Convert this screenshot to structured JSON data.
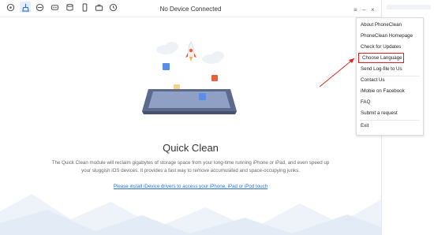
{
  "window": {
    "title": "No Device Connected"
  },
  "toolbar": {
    "icons": [
      "device-icon",
      "clean-icon",
      "sync-icon",
      "mask-icon",
      "database-icon",
      "phone-icon",
      "toolbox-icon",
      "history-icon"
    ],
    "menu_glyph": "≡",
    "minimize_glyph": "–",
    "close_glyph": "×"
  },
  "main": {
    "heading": "Quick Clean",
    "description": "The Quick Clean module will reclaim gigabytes of storage space from your long-time running iPhone or iPad, and even speed up your sluggish iOS devices. It provides a fast way to remove accumulated and space-occupying junks.",
    "link_text": "Please install iDevice drivers to access your iPhone, iPad or iPod touch"
  },
  "menu": {
    "items": [
      "About PhoneClean",
      "PhoneClean Homepage",
      "Check for Updates",
      "Choose Language",
      "Send Log-file to Us",
      "Contact Us",
      "iMobie on Facebook",
      "FAQ",
      "Submit a request",
      "Exit"
    ],
    "highlighted_index": 3
  },
  "colors": {
    "accent": "#2b6fd6",
    "highlight_border": "#e01e1e",
    "rocket": "#e8603c",
    "tablet": "#5a6b8f"
  }
}
